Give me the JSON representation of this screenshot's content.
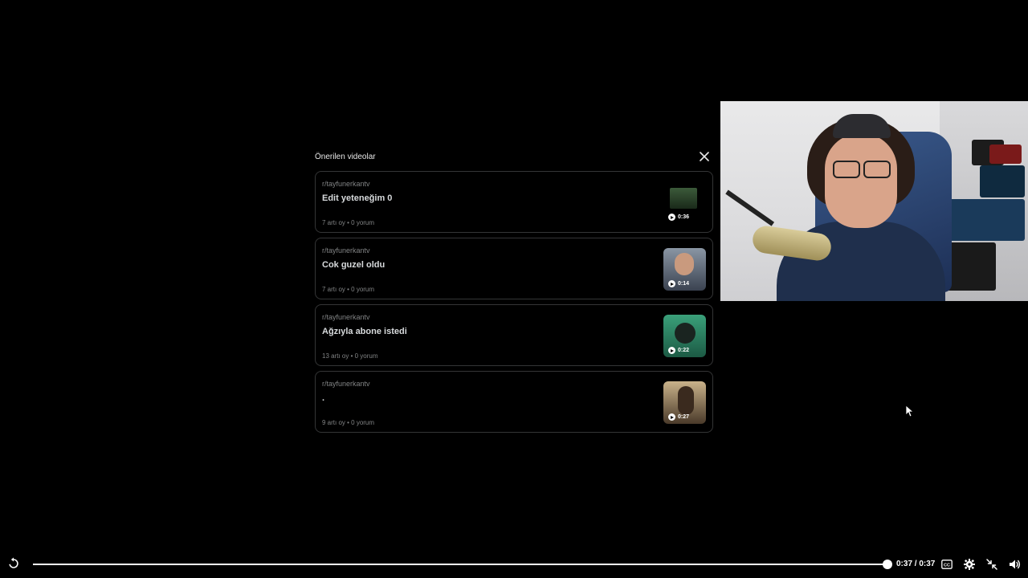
{
  "panel": {
    "title": "Önerilen videolar",
    "items": [
      {
        "subreddit": "r/tayfunerkantv",
        "title": "Edit yeteneğim 0",
        "meta": "7 artı oy • 0 yorum",
        "duration": "0:36",
        "thumb_color": "#1c2a1c"
      },
      {
        "subreddit": "r/tayfunerkantv",
        "title": "Cok guzel oldu",
        "meta": "7 artı oy • 0 yorum",
        "duration": "0:14",
        "thumb_color": "#6f7b8a"
      },
      {
        "subreddit": "r/tayfunerkantv",
        "title": "Ağzıyla abone istedi",
        "meta": "13 artı oy • 0 yorum",
        "duration": "0:22",
        "thumb_color": "#2e8c6a"
      },
      {
        "subreddit": "r/tayfunerkantv",
        "title": ".",
        "meta": "9 artı oy • 0 yorum",
        "duration": "0:27",
        "thumb_color": "#7a6a4a"
      }
    ]
  },
  "player": {
    "time": "0:37 / 0:37",
    "progress": 1.0
  },
  "colors": {
    "background": "#000000",
    "card_border": "#343536",
    "text_primary": "#d7dadc",
    "text_secondary": "#818384"
  },
  "icons": [
    "close-icon",
    "replay-icon",
    "play-icon",
    "captions-icon",
    "gear-icon",
    "fullscreen-exit-icon",
    "volume-icon",
    "mouse-cursor-icon"
  ]
}
